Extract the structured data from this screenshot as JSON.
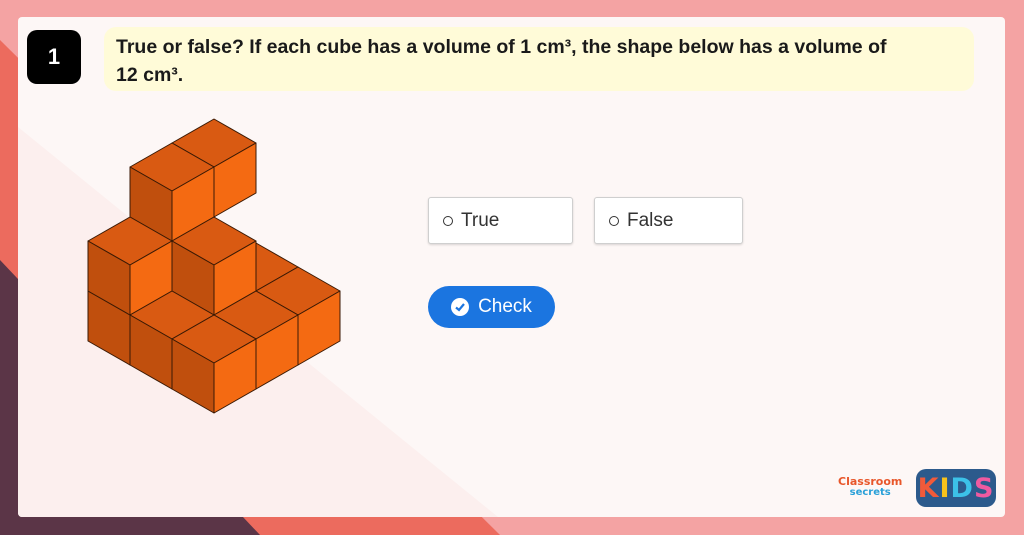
{
  "question": {
    "number": "1",
    "line1": "True or false? If each cube has a volume of 1 cm³, the shape below has a volume of",
    "line2": "12 cm³."
  },
  "options": [
    {
      "label": "True"
    },
    {
      "label": "False"
    }
  ],
  "check_button": {
    "label": "Check"
  },
  "branding": {
    "classroom": "Classroom",
    "secrets": "secrets",
    "kids": [
      "K",
      "I",
      "D",
      "S"
    ]
  },
  "colors": {
    "cube_top": "#d95a12",
    "cube_left": "#c04f0d",
    "cube_right": "#f46a12",
    "check_button": "#1b75e0",
    "question_bg": "#fffbd8"
  }
}
